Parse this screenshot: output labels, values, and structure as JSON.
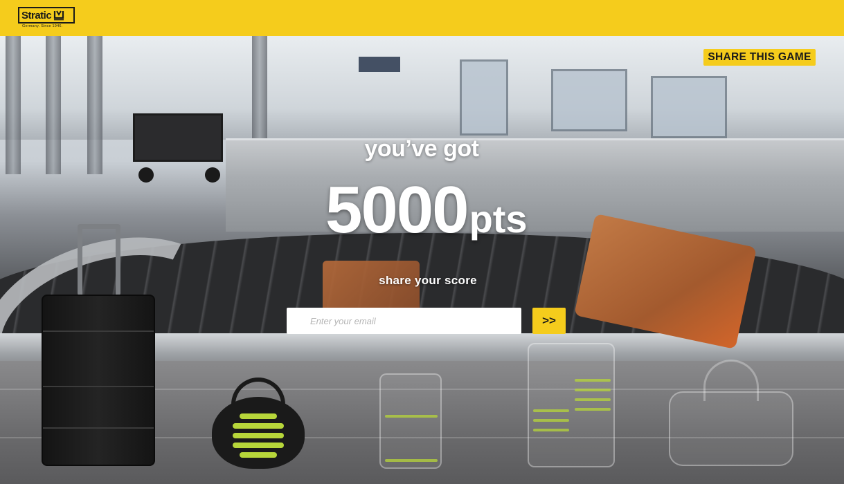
{
  "header": {
    "logo_text": "Stratic",
    "logo_tagline": "Germany. Since 1946."
  },
  "share_game_label": "SHARE THIS GAME",
  "result": {
    "heading": "you’ve got",
    "score": "5000",
    "unit": "pts",
    "share_prompt": "share your score"
  },
  "email": {
    "placeholder": "Enter your email",
    "value": ""
  },
  "submit_label": ">>",
  "colors": {
    "brand_yellow": "#f5cc1c",
    "accent_lime": "#b7d63a",
    "text_dark": "#1a1a1a"
  }
}
